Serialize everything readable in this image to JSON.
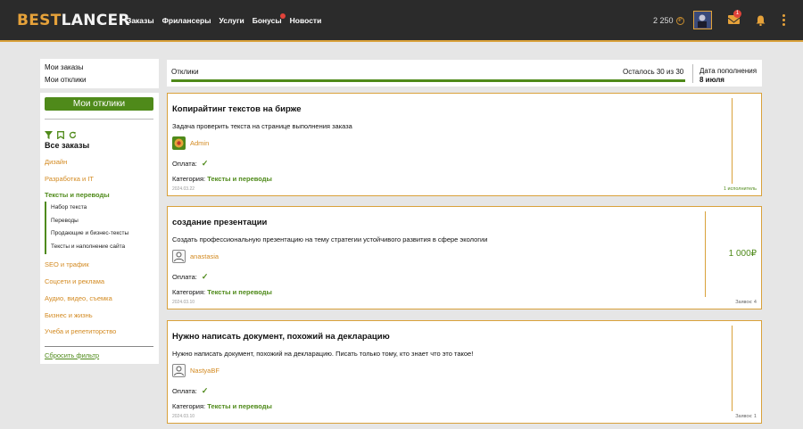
{
  "brand": {
    "part1": "BEST",
    "part2": "LANCER"
  },
  "nav": [
    "Заказы",
    "Фрилансеры",
    "Услуги",
    "Бонусы",
    "Новости"
  ],
  "balance": "2 250",
  "coin_symbol": "₽",
  "messages_badge": "1",
  "sidebar_top": [
    "Мои заказы",
    "Мои отклики"
  ],
  "sidebar": {
    "button": "Мои отклики",
    "all_orders": "Все заказы",
    "categories": [
      "Дизайн",
      "Разработка и IT",
      "Тексты и переводы"
    ],
    "subcategories": [
      "Набор текста",
      "Переводы",
      "Продающие и бизнес-тексты",
      "Тексты и наполнение сайта"
    ],
    "categories_after": [
      "SEO и трафик",
      "Соцсети и реклама",
      "Аудио, видео, съемка",
      "Бизнес и жизнь",
      "Учеба и репетиторство"
    ],
    "reset": "Сбросить фильтр"
  },
  "responses": {
    "label": "Отклики",
    "remaining": "Осталось 30 из 30",
    "progress": 1.0,
    "refill_label": "Дата пополнения",
    "refill_date": "8 июля"
  },
  "orders": [
    {
      "title": "Копирайтинг текстов на бирже",
      "desc": "Задача проверить текста на странице выполнения заказа",
      "user": "Admin",
      "pay_label": "Оплата:",
      "category_label": "Категория:",
      "category": "Тексты и переводы",
      "date": "2024.03.22",
      "price": "",
      "stat": "1 исполнитель"
    },
    {
      "title": "создание презентации",
      "desc": "Создать профессиональную презентацию на тему стратегии устойчивого развития в сфере экологии",
      "user": "anastasia",
      "pay_label": "Оплата:",
      "category_label": "Категория:",
      "category": "Тексты и переводы",
      "date": "2024.03.10",
      "price": "1 000₽",
      "stat": "Заявок: 4"
    },
    {
      "title": "Нужно написать документ, похожий на декларацию",
      "desc": "Нужно написать документ, похожий на декларацию. Писать только тому, кто знает что это такое!",
      "user": "NastyaBF",
      "pay_label": "Оплата:",
      "category_label": "Категория:",
      "category": "Тексты и переводы",
      "date": "2024.03.10",
      "price": "",
      "stat": "Заявок: 1"
    }
  ],
  "colors": {
    "accent": "#d9a13a",
    "green": "#4f8a1a",
    "dark": "#2b2b2b"
  }
}
